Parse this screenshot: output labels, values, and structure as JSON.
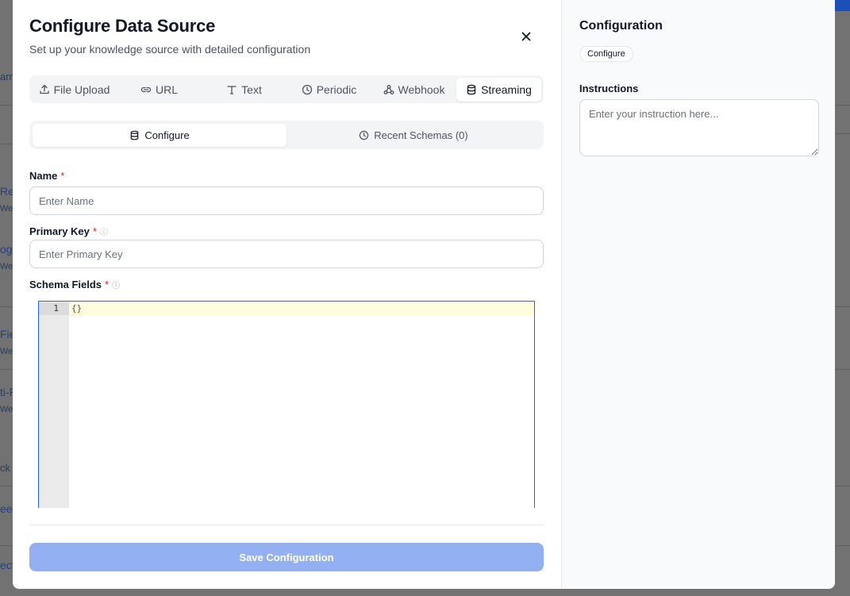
{
  "background": {
    "rows": [
      {
        "text": "arn",
        "kind": "text"
      },
      {
        "text": "Rep",
        "kind": "link"
      },
      {
        "text": "Web",
        "kind": "text"
      },
      {
        "text": "og",
        "kind": "link"
      },
      {
        "text": "Web",
        "kind": "text"
      },
      {
        "text": "Fie",
        "kind": "link"
      },
      {
        "text": "Web",
        "kind": "text"
      },
      {
        "text": "ti-F",
        "kind": "link"
      },
      {
        "text": "Web",
        "kind": "text"
      },
      {
        "text": "ck",
        "kind": "text"
      },
      {
        "text": "eep",
        "kind": "link"
      },
      {
        "text": "ect",
        "kind": "link"
      }
    ]
  },
  "modal": {
    "title": "Configure Data Source",
    "subtitle": "Set up your knowledge source with detailed configuration",
    "close_label": "×",
    "source_tabs": [
      {
        "label": "File Upload",
        "icon": "upload-icon",
        "active": false
      },
      {
        "label": "URL",
        "icon": "link-icon",
        "active": false
      },
      {
        "label": "Text",
        "icon": "text-icon",
        "active": false
      },
      {
        "label": "Periodic",
        "icon": "clock-icon",
        "active": false
      },
      {
        "label": "Webhook",
        "icon": "webhook-icon",
        "active": false
      },
      {
        "label": "Streaming",
        "icon": "database-icon",
        "active": true
      }
    ],
    "sub_tabs": [
      {
        "label": "Configure",
        "icon": "database-icon",
        "active": true
      },
      {
        "label": "Recent Schemas (0)",
        "icon": "clock-icon",
        "active": false
      }
    ],
    "fields": {
      "name": {
        "label": "Name",
        "required_mark": "*",
        "placeholder": "Enter Name",
        "value": ""
      },
      "primary_key": {
        "label": "Primary Key",
        "required_mark": "*",
        "info": "ⓘ",
        "placeholder": "Enter Primary Key",
        "value": ""
      },
      "schema_fields": {
        "label": "Schema Fields",
        "required_mark": "*",
        "info": "ⓘ",
        "line_number": "1",
        "code": "{}"
      }
    },
    "save_label": "Save Configuration"
  },
  "config_panel": {
    "title": "Configuration",
    "badge": "Configure",
    "instructions_label": "Instructions",
    "instructions_placeholder": "Enter your instruction here..."
  }
}
